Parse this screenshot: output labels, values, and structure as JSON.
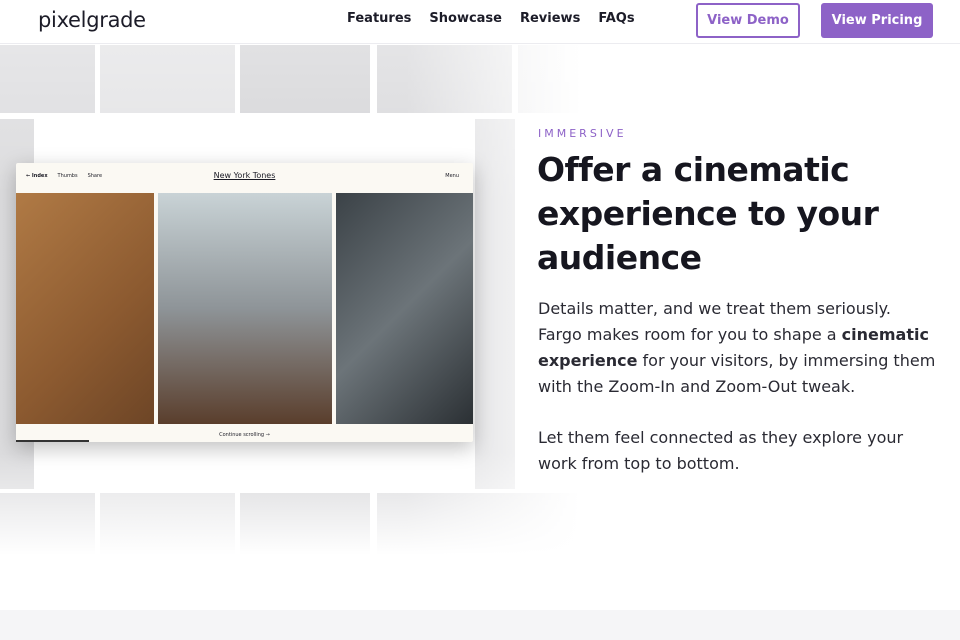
{
  "nav": {
    "logo": "pixelgrade",
    "links": [
      "Features",
      "Showcase",
      "Reviews",
      "FAQs"
    ],
    "demo": "View Demo",
    "pricing": "View Pricing"
  },
  "mockup": {
    "back": "← Index",
    "thumbs": "Thumbs",
    "share": "Share",
    "title": "New York Tones",
    "menu": "Menu",
    "continue": "Continue scrolling →",
    "progress_percent": 16
  },
  "hero": {
    "eyebrow": "IMMERSIVE",
    "title": "Offer a cinematic experience to your audience",
    "p1_a": "Details matter, and we treat them seriously. Fargo makes room for you to shape a ",
    "p1_bold": "cinematic experience",
    "p1_b": " for your visitors, by immersing them with the Zoom-In and Zoom-Out tweak.",
    "p2": "Let them feel connected as they explore your work from top to bottom."
  },
  "colors": {
    "accent": "#8d62c7"
  }
}
